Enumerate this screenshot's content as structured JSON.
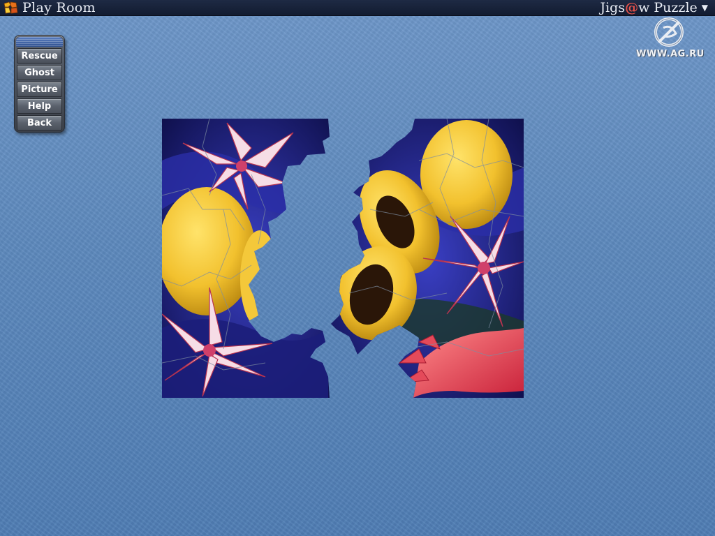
{
  "titlebar": {
    "title": "Play Room",
    "brand_prefix": "Jigs",
    "brand_at": "@",
    "brand_suffix": "w Puzzle",
    "dropdown_arrow": "▼"
  },
  "watermark": {
    "text": "WWW.AG.RU"
  },
  "menu": {
    "items": [
      {
        "label": "Rescue"
      },
      {
        "label": "Ghost"
      },
      {
        "label": "Picture"
      },
      {
        "label": "Help"
      },
      {
        "label": "Back"
      }
    ]
  },
  "puzzle": {
    "image_subject": "papayas and lilies",
    "left_group_pieces": "assembled",
    "right_group_pieces": "assembled",
    "icons": [
      "app-logo-icon",
      "watermark-logo-icon",
      "dropdown-arrow-icon"
    ]
  },
  "colors": {
    "titlebar_bg": "#121b30",
    "desk_bg": "#5d89bd",
    "menu_bg": "#4b515b",
    "brand_accent": "#e8524a"
  }
}
